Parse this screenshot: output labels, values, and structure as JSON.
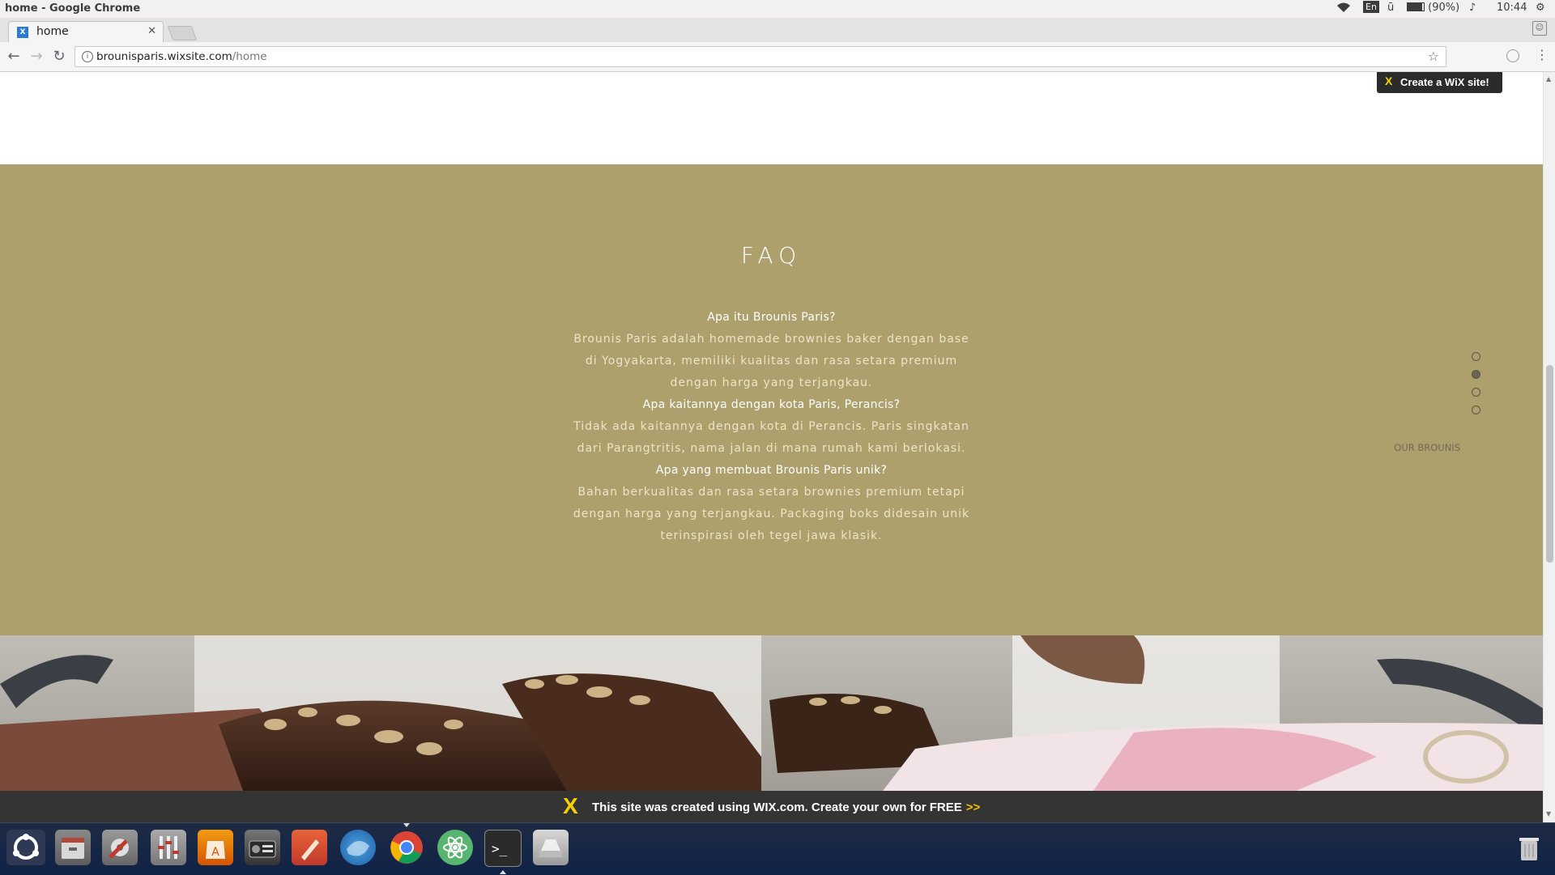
{
  "os": {
    "window_title": "home - Google Chrome",
    "keyboard": "En",
    "battery": "(90%)",
    "clock": "10:44"
  },
  "browser": {
    "tab_title": "home",
    "url_host": "brounisparis.wixsite.com",
    "url_path": "/home"
  },
  "wix": {
    "create_site_label": "Create a WiX site!",
    "banner_text": "This site was created using WIX.com. Create your own for FREE",
    "banner_arrows": ">>"
  },
  "faq": {
    "title": "FAQ",
    "items": [
      {
        "question": "Apa itu Brounis Paris?",
        "answer": "Brounis Paris adalah homemade brownies baker dengan base di Yogyakarta, memiliki kualitas dan rasa setara premium dengan harga yang terjangkau."
      },
      {
        "question": "Apa kaitannya dengan kota Paris, Perancis?",
        "answer": "Tidak ada kaitannya dengan kota di Perancis. Paris singkatan dari Parangtritis, nama jalan di mana rumah kami berlokasi."
      },
      {
        "question": "Apa yang membuat Brounis Paris unik?",
        "answer": "Bahan berkualitas dan rasa setara brownies premium tetapi dengan harga yang terjangkau. Packaging boks didesain unik terinspirasi oleh tegel jawa klasik."
      }
    ]
  },
  "section_nav": {
    "active_label": "OUR BROUNIS",
    "dot_count": 4,
    "active_index": 1
  },
  "colors": {
    "faq_background": "#ada06c",
    "wix_banner": "#343434",
    "wix_accent": "#f3d200"
  },
  "dock": {
    "items": [
      "ubuntu-dash-icon",
      "files-icon",
      "system-settings-icon",
      "system-monitor-icon",
      "software-center-icon",
      "radio-icon",
      "pen-tool-icon",
      "thunderbird-icon",
      "chrome-icon",
      "atom-icon",
      "terminal-icon",
      "drive-icon",
      "trash-icon"
    ]
  }
}
